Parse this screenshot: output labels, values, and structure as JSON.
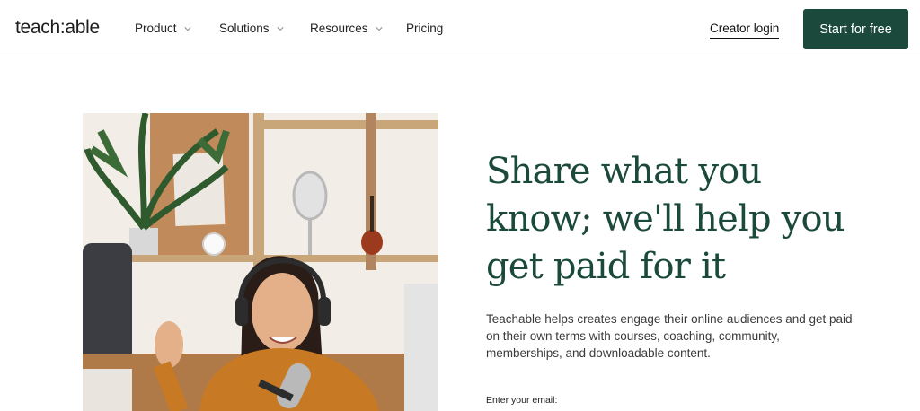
{
  "nav": {
    "logo": "teach:able",
    "items": [
      {
        "label": "Product",
        "has_dropdown": true
      },
      {
        "label": "Solutions",
        "has_dropdown": true
      },
      {
        "label": "Resources",
        "has_dropdown": true
      },
      {
        "label": "Pricing",
        "has_dropdown": false
      }
    ],
    "login_label": "Creator login",
    "cta_label": "Start for free"
  },
  "hero": {
    "title_lines": [
      "Share what you",
      "know; we'll help you",
      "get paid for it"
    ],
    "description": "Teachable helps creates engage their online audiences and get paid on their own terms with courses, coaching, community, memberships, and downloadable content.",
    "email_label": "Enter your email:"
  },
  "colors": {
    "brand_green": "#1b4a3c",
    "cta_background": "#1b4a3c",
    "text_dark": "#1c1c1c"
  }
}
